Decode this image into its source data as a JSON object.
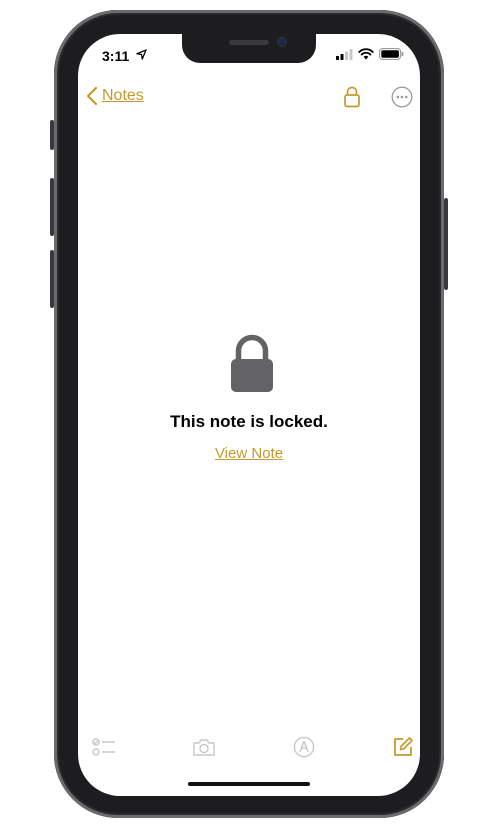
{
  "status_bar": {
    "time": "3:11"
  },
  "nav": {
    "back_label": "Notes"
  },
  "content": {
    "locked_message": "This note is locked.",
    "view_note_label": "View Note"
  },
  "colors": {
    "accent": "#c59a2c",
    "lock_gray": "#636366",
    "toolbar_icon": "#c7c7cc"
  },
  "icons": {
    "back": "chevron-left-icon",
    "lock": "lock-icon",
    "more": "ellipsis-circle-icon",
    "checklist": "checklist-icon",
    "camera": "camera-icon",
    "markup": "pen-circle-icon",
    "compose": "compose-icon"
  }
}
